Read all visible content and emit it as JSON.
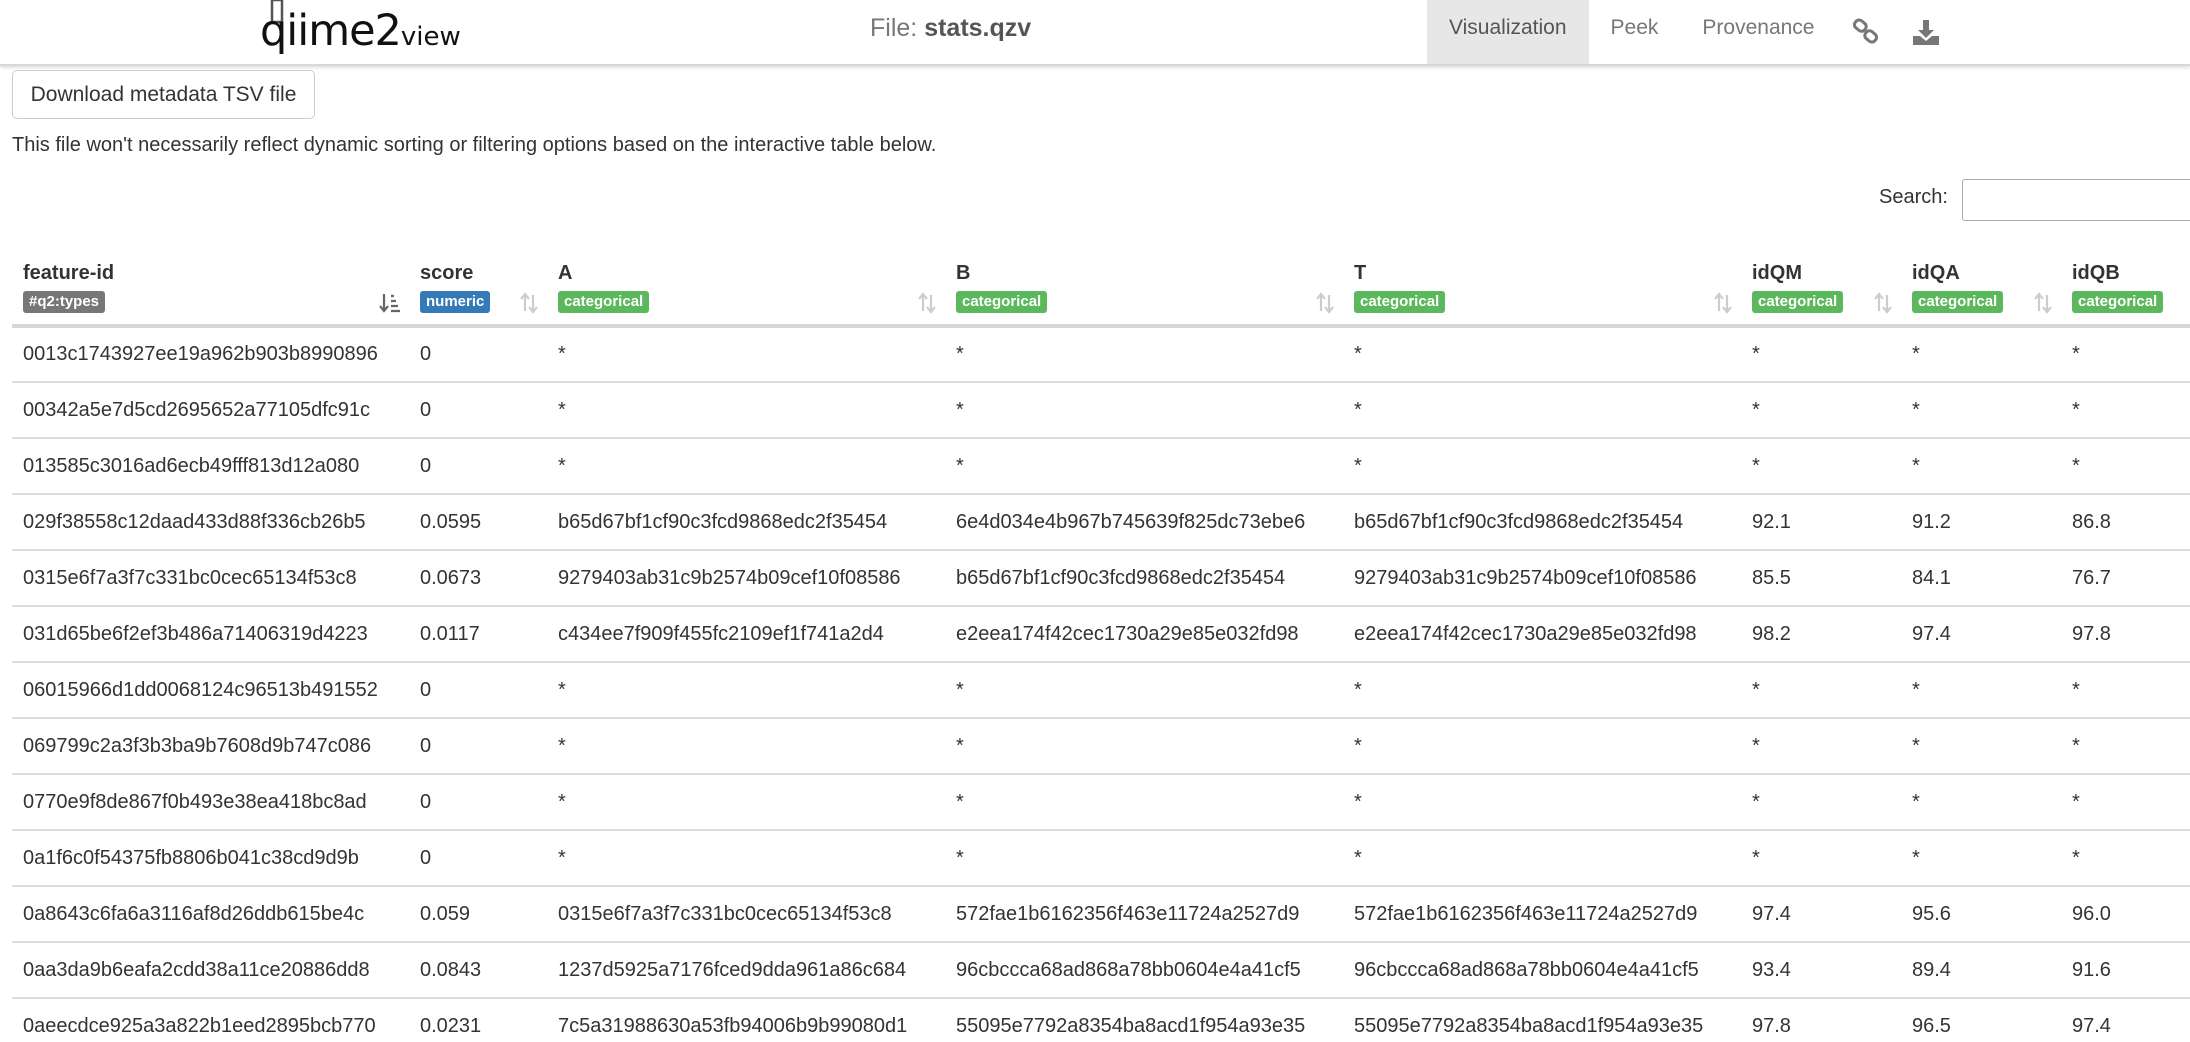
{
  "navbar": {
    "logo_main": "qiime2",
    "logo_sub": "view",
    "file_label": "File:",
    "file_name": "stats.qzv",
    "tabs": [
      {
        "label": "Visualization",
        "active": true
      },
      {
        "label": "Peek",
        "active": false
      },
      {
        "label": "Provenance",
        "active": false
      }
    ],
    "icons": [
      "link-icon",
      "download-icon"
    ]
  },
  "controls": {
    "download_label": "Download metadata TSV file",
    "note": "This file won't necessarily reflect dynamic sorting or filtering options based on the interactive table below.",
    "search_label": "Search:",
    "search_value": ""
  },
  "table": {
    "columns": [
      {
        "name": "feature-id",
        "type": "#q2:types",
        "sort": "ascending"
      },
      {
        "name": "score",
        "type": "numeric"
      },
      {
        "name": "A",
        "type": "categorical"
      },
      {
        "name": "B",
        "type": "categorical"
      },
      {
        "name": "T",
        "type": "categorical"
      },
      {
        "name": "idQM",
        "type": "categorical"
      },
      {
        "name": "idQA",
        "type": "categorical"
      },
      {
        "name": "idQB",
        "type": "categorical"
      }
    ],
    "rows": [
      [
        "0013c1743927ee19a962b903b8990896",
        "0",
        "*",
        "*",
        "*",
        "*",
        "*",
        "*"
      ],
      [
        "00342a5e7d5cd2695652a77105dfc91c",
        "0",
        "*",
        "*",
        "*",
        "*",
        "*",
        "*"
      ],
      [
        "013585c3016ad6ecb49fff813d12a080",
        "0",
        "*",
        "*",
        "*",
        "*",
        "*",
        "*"
      ],
      [
        "029f38558c12daad433d88f336cb26b5",
        "0.0595",
        "b65d67bf1cf90c3fcd9868edc2f35454",
        "6e4d034e4b967b745639f825dc73ebe6",
        "b65d67bf1cf90c3fcd9868edc2f35454",
        "92.1",
        "91.2",
        "86.8"
      ],
      [
        "0315e6f7a3f7c331bc0cec65134f53c8",
        "0.0673",
        "9279403ab31c9b2574b09cef10f08586",
        "b65d67bf1cf90c3fcd9868edc2f35454",
        "9279403ab31c9b2574b09cef10f08586",
        "85.5",
        "84.1",
        "76.7"
      ],
      [
        "031d65be6f2ef3b486a71406319d4223",
        "0.0117",
        "c434ee7f909f455fc2109ef1f741a2d4",
        "e2eea174f42cec1730a29e85e032fd98",
        "e2eea174f42cec1730a29e85e032fd98",
        "98.2",
        "97.4",
        "97.8"
      ],
      [
        "06015966d1dd0068124c96513b491552",
        "0",
        "*",
        "*",
        "*",
        "*",
        "*",
        "*"
      ],
      [
        "069799c2a3f3b3ba9b7608d9b747c086",
        "0",
        "*",
        "*",
        "*",
        "*",
        "*",
        "*"
      ],
      [
        "0770e9f8de867f0b493e38ea418bc8ad",
        "0",
        "*",
        "*",
        "*",
        "*",
        "*",
        "*"
      ],
      [
        "0a1f6c0f54375fb8806b041c38cd9d9b",
        "0",
        "*",
        "*",
        "*",
        "*",
        "*",
        "*"
      ],
      [
        "0a8643c6fa6a3116af8d26ddb615be4c",
        "0.059",
        "0315e6f7a3f7c331bc0cec65134f53c8",
        "572fae1b6162356f463e11724a2527d9",
        "572fae1b6162356f463e11724a2527d9",
        "97.4",
        "95.6",
        "96.0"
      ],
      [
        "0aa3da9b6eafa2cdd38a11ce20886dd8",
        "0.0843",
        "1237d5925a7176fced9dda961a86c684",
        "96cbccca68ad868a78bb0604e4a41cf5",
        "96cbccca68ad868a78bb0604e4a41cf5",
        "93.4",
        "89.4",
        "91.6"
      ],
      [
        "0aeecdce925a3a822b1eed2895bcb770",
        "0.0231",
        "7c5a31988630a53fb94006b9b99080d1",
        "55095e7792a8354ba8acd1f954a93e35",
        "55095e7792a8354ba8acd1f954a93e35",
        "97.8",
        "96.5",
        "97.4"
      ]
    ]
  },
  "colors": {
    "badge_q2": "#777777",
    "badge_numeric": "#337ab7",
    "badge_categorical": "#5cb85c",
    "nav_active_bg": "#e7e7e7"
  }
}
